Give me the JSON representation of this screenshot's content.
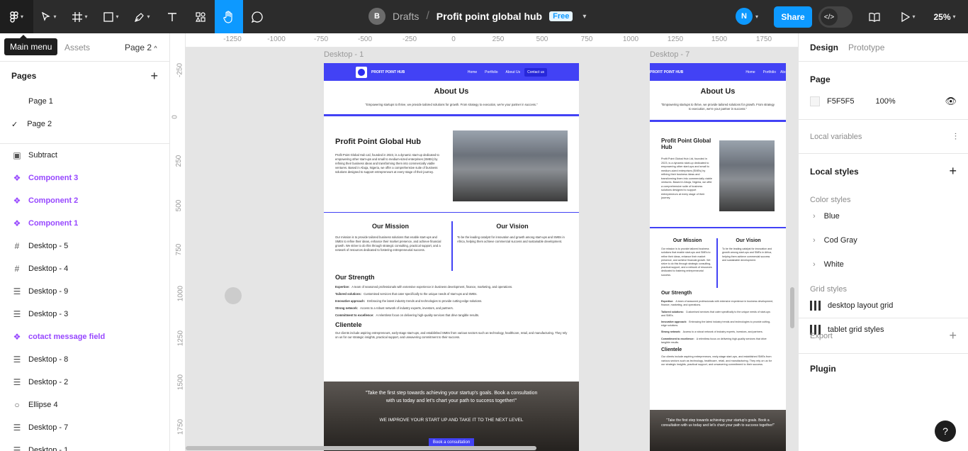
{
  "toolbar": {
    "zoom": "25%",
    "share_label": "Share",
    "breadcrumb_parent": "Drafts",
    "file_name": "Profit point global hub",
    "plan_badge": "Free",
    "avatar_initial": "B",
    "user_initial": "N",
    "tooltip": "Main menu"
  },
  "left_panel": {
    "tab_assets": "Assets",
    "current_page": "Page 2",
    "pages_title": "Pages",
    "pages": [
      "Page 1",
      "Page 2"
    ],
    "layers": [
      {
        "name": "Subtract",
        "kind": "subtract"
      },
      {
        "name": "Component 3",
        "kind": "component"
      },
      {
        "name": "Component 2",
        "kind": "component"
      },
      {
        "name": "Component 1",
        "kind": "component"
      },
      {
        "name": "Desktop - 5",
        "kind": "frame"
      },
      {
        "name": "Desktop - 4",
        "kind": "frame"
      },
      {
        "name": "Desktop - 9",
        "kind": "lines"
      },
      {
        "name": "Desktop - 3",
        "kind": "lines"
      },
      {
        "name": "cotact message field",
        "kind": "component"
      },
      {
        "name": "Desktop - 8",
        "kind": "lines"
      },
      {
        "name": "Desktop - 2",
        "kind": "lines"
      },
      {
        "name": "Ellipse 4",
        "kind": "ellipse"
      },
      {
        "name": "Desktop - 7",
        "kind": "lines"
      },
      {
        "name": "Desktop - 1",
        "kind": "lines"
      }
    ]
  },
  "rulers": {
    "top": [
      "-1250",
      "-1000",
      "-750",
      "-500",
      "-250",
      "0",
      "250",
      "500",
      "750",
      "1000",
      "1250",
      "1500",
      "1750"
    ],
    "left": [
      "-250",
      "0",
      "250",
      "500",
      "750",
      "1000",
      "1250",
      "1500",
      "1750"
    ]
  },
  "canvas": {
    "frame1_label": "Desktop - 1",
    "frame2_label": "Desktop - 7",
    "site": {
      "brand": "PROFIT POINT HUB",
      "nav": [
        "Home",
        "Portfolio",
        "About Us",
        "Contact us"
      ],
      "about_title": "About Us",
      "about_quote": "\"Empowering startups to thrive, we provide tailored solutions for growth. From strategy to execution, we're your partner in success.\"",
      "hub_title": "Profit Point Global Hub",
      "hub_text": "Profit Point Global Hub Ltd, founded in 2023, is a dynamic start-up dedicated to empowering other start-ups and small to medium-sized enterprises (SMEs) by refining their business ideas and transforming them into commercially viable ventures. Based in Abuja, Nigeria, we offer a comprehensive suite of business solutions designed to support entrepreneurs at every stage of their journey.",
      "mission_title": "Our Mission",
      "mission_text": "Our mission is to provide tailored business solutions that enable start-ups and SMEs to refine their ideas, enhance their market presence, and achieve financial growth. We strive to do this through strategic consulting, practical support, and a network of resources dedicated to fostering entrepreneurial success.",
      "vision_title": "Our Vision",
      "vision_text": "To be the leading catalyst for innovation and growth among start-ups and SMEs in Africa, helping them achieve commercial success and sustainable development.",
      "strength_title": "Our Strength",
      "strengths": [
        {
          "k": "Expertise:",
          "v": "A team of seasoned professionals with extensive experience in business development, finance, marketing, and operations."
        },
        {
          "k": "Tailored solutions:",
          "v": "Customised services that cater specifically to the unique needs of start-ups and SMEs."
        },
        {
          "k": "Innovative approach:",
          "v": "Embracing the latest industry trends and technologies to provide cutting-edge solutions."
        },
        {
          "k": "Strong network:",
          "v": "Access to a robust network of industry experts, investors, and partners."
        },
        {
          "k": "Commitment to excellence:",
          "v": "A relentless focus on delivering high-quality services that drive tangible results."
        }
      ],
      "clientele_title": "Clientele",
      "clientele_text": "Our clients include aspiring entrepreneurs, early-stage start-ups, and established SMEs from various sectors such as technology, healthcare, retail, and manufacturing. They rely on us for our strategic insights, practical support, and unwavering commitment to their success.",
      "cta_quote": "\"Take the first step towards achieving your startup's goals. Book a consultation with us today and let's chart your path to success together!\"",
      "cta_line": "WE IMPROVE YOUR START UP AND TAKE IT TO THE NEXT LEVEL",
      "cta_button": "Book a consultation"
    }
  },
  "right_panel": {
    "tab_design": "Design",
    "tab_prototype": "Prototype",
    "page_title": "Page",
    "page_color": "F5F5F5",
    "page_opacity": "100%",
    "local_variables": "Local variables",
    "local_styles": "Local styles",
    "color_styles_title": "Color styles",
    "color_styles": [
      "Blue",
      "Cod Gray",
      "White"
    ],
    "grid_styles_title": "Grid styles",
    "grid_styles": [
      "desktop layout grid",
      "tablet grid styles"
    ],
    "export": "Export",
    "plugin": "Plugin",
    "help": "?"
  }
}
